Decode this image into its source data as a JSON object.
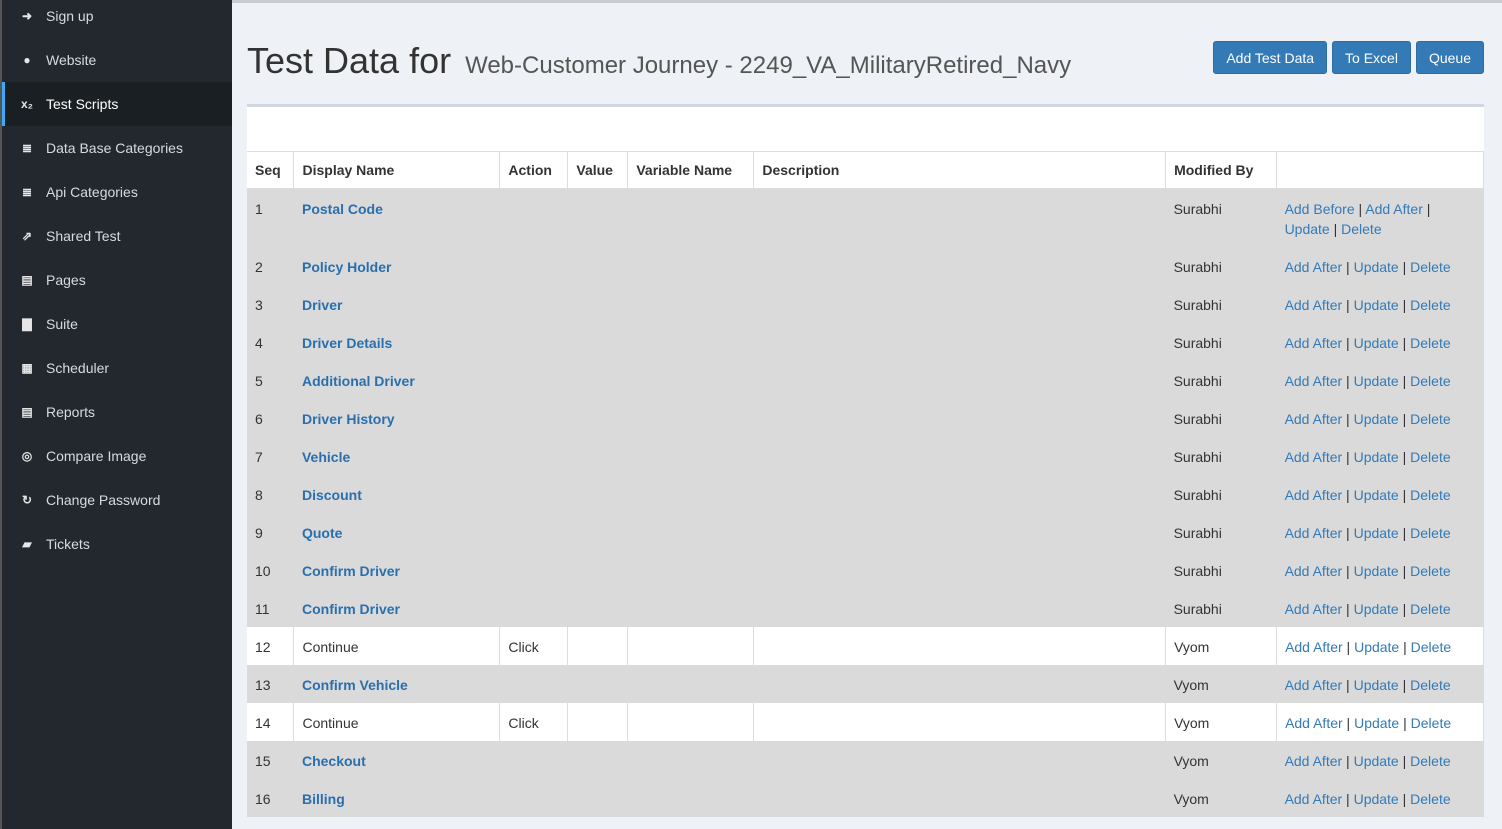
{
  "sidebar": {
    "items": [
      {
        "label": "Sign up",
        "icon": "sign-in-icon",
        "glyph": "➜",
        "active": false
      },
      {
        "label": "Website",
        "icon": "globe-icon",
        "glyph": "●",
        "active": false
      },
      {
        "label": "Test Scripts",
        "icon": "subscript-icon",
        "glyph": "x₂",
        "active": true
      },
      {
        "label": "Data Base Categories",
        "icon": "database-icon",
        "glyph": "≣",
        "active": false
      },
      {
        "label": "Api Categories",
        "icon": "database-icon",
        "glyph": "≣",
        "active": false
      },
      {
        "label": "Shared Test",
        "icon": "share-icon",
        "glyph": "⇗",
        "active": false
      },
      {
        "label": "Pages",
        "icon": "list-alt-icon",
        "glyph": "▤",
        "active": false
      },
      {
        "label": "Suite",
        "icon": "briefcase-icon",
        "glyph": "▇",
        "active": false
      },
      {
        "label": "Scheduler",
        "icon": "calendar-icon",
        "glyph": "▦",
        "active": false
      },
      {
        "label": "Reports",
        "icon": "file-text-icon",
        "glyph": "▤",
        "active": false
      },
      {
        "label": "Compare Image",
        "icon": "compass-icon",
        "glyph": "◎",
        "active": false
      },
      {
        "label": "Change Password",
        "icon": "refresh-icon",
        "glyph": "↻",
        "active": false
      },
      {
        "label": "Tickets",
        "icon": "book-icon",
        "glyph": "▰",
        "active": false
      }
    ]
  },
  "header": {
    "title": "Test Data for",
    "subtitle": "Web-Customer Journey - 2249_VA_MilitaryRetired_Navy",
    "buttons": {
      "add": "Add Test Data",
      "excel": "To Excel",
      "queue": "Queue"
    }
  },
  "table": {
    "columns": [
      "Seq",
      "Display Name",
      "Action",
      "Value",
      "Variable Name",
      "Description",
      "Modified By",
      ""
    ],
    "links": {
      "add_before": "Add Before",
      "add_after": "Add After",
      "update": "Update",
      "delete": "Delete"
    },
    "rows": [
      {
        "seq": "1",
        "name": "Postal Code",
        "action": "",
        "value": "",
        "variable": "",
        "description": "",
        "modified_by": "Surabhi",
        "is_group": true,
        "has_add_before": true
      },
      {
        "seq": "2",
        "name": "Policy Holder",
        "action": "",
        "value": "",
        "variable": "",
        "description": "",
        "modified_by": "Surabhi",
        "is_group": true,
        "has_add_before": false
      },
      {
        "seq": "3",
        "name": "Driver",
        "action": "",
        "value": "",
        "variable": "",
        "description": "",
        "modified_by": "Surabhi",
        "is_group": true,
        "has_add_before": false
      },
      {
        "seq": "4",
        "name": "Driver Details",
        "action": "",
        "value": "",
        "variable": "",
        "description": "",
        "modified_by": "Surabhi",
        "is_group": true,
        "has_add_before": false
      },
      {
        "seq": "5",
        "name": "Additional Driver",
        "action": "",
        "value": "",
        "variable": "",
        "description": "",
        "modified_by": "Surabhi",
        "is_group": true,
        "has_add_before": false
      },
      {
        "seq": "6",
        "name": "Driver History",
        "action": "",
        "value": "",
        "variable": "",
        "description": "",
        "modified_by": "Surabhi",
        "is_group": true,
        "has_add_before": false
      },
      {
        "seq": "7",
        "name": "Vehicle",
        "action": "",
        "value": "",
        "variable": "",
        "description": "",
        "modified_by": "Surabhi",
        "is_group": true,
        "has_add_before": false
      },
      {
        "seq": "8",
        "name": "Discount",
        "action": "",
        "value": "",
        "variable": "",
        "description": "",
        "modified_by": "Surabhi",
        "is_group": true,
        "has_add_before": false
      },
      {
        "seq": "9",
        "name": "Quote",
        "action": "",
        "value": "",
        "variable": "",
        "description": "",
        "modified_by": "Surabhi",
        "is_group": true,
        "has_add_before": false
      },
      {
        "seq": "10",
        "name": "Confirm Driver",
        "action": "",
        "value": "",
        "variable": "",
        "description": "",
        "modified_by": "Surabhi",
        "is_group": true,
        "has_add_before": false
      },
      {
        "seq": "11",
        "name": "Confirm Driver",
        "action": "",
        "value": "",
        "variable": "",
        "description": "",
        "modified_by": "Surabhi",
        "is_group": true,
        "has_add_before": false
      },
      {
        "seq": "12",
        "name": "Continue",
        "action": "Click",
        "value": "",
        "variable": "",
        "description": "",
        "modified_by": "Vyom",
        "is_group": false,
        "has_add_before": false
      },
      {
        "seq": "13",
        "name": "Confirm Vehicle",
        "action": "",
        "value": "",
        "variable": "",
        "description": "",
        "modified_by": "Vyom",
        "is_group": true,
        "has_add_before": false
      },
      {
        "seq": "14",
        "name": "Continue",
        "action": "Click",
        "value": "",
        "variable": "",
        "description": "",
        "modified_by": "Vyom",
        "is_group": false,
        "has_add_before": false
      },
      {
        "seq": "15",
        "name": "Checkout",
        "action": "",
        "value": "",
        "variable": "",
        "description": "",
        "modified_by": "Vyom",
        "is_group": true,
        "has_add_before": false
      },
      {
        "seq": "16",
        "name": "Billing",
        "action": "",
        "value": "",
        "variable": "",
        "description": "",
        "modified_by": "Vyom",
        "is_group": true,
        "has_add_before": false
      }
    ]
  }
}
